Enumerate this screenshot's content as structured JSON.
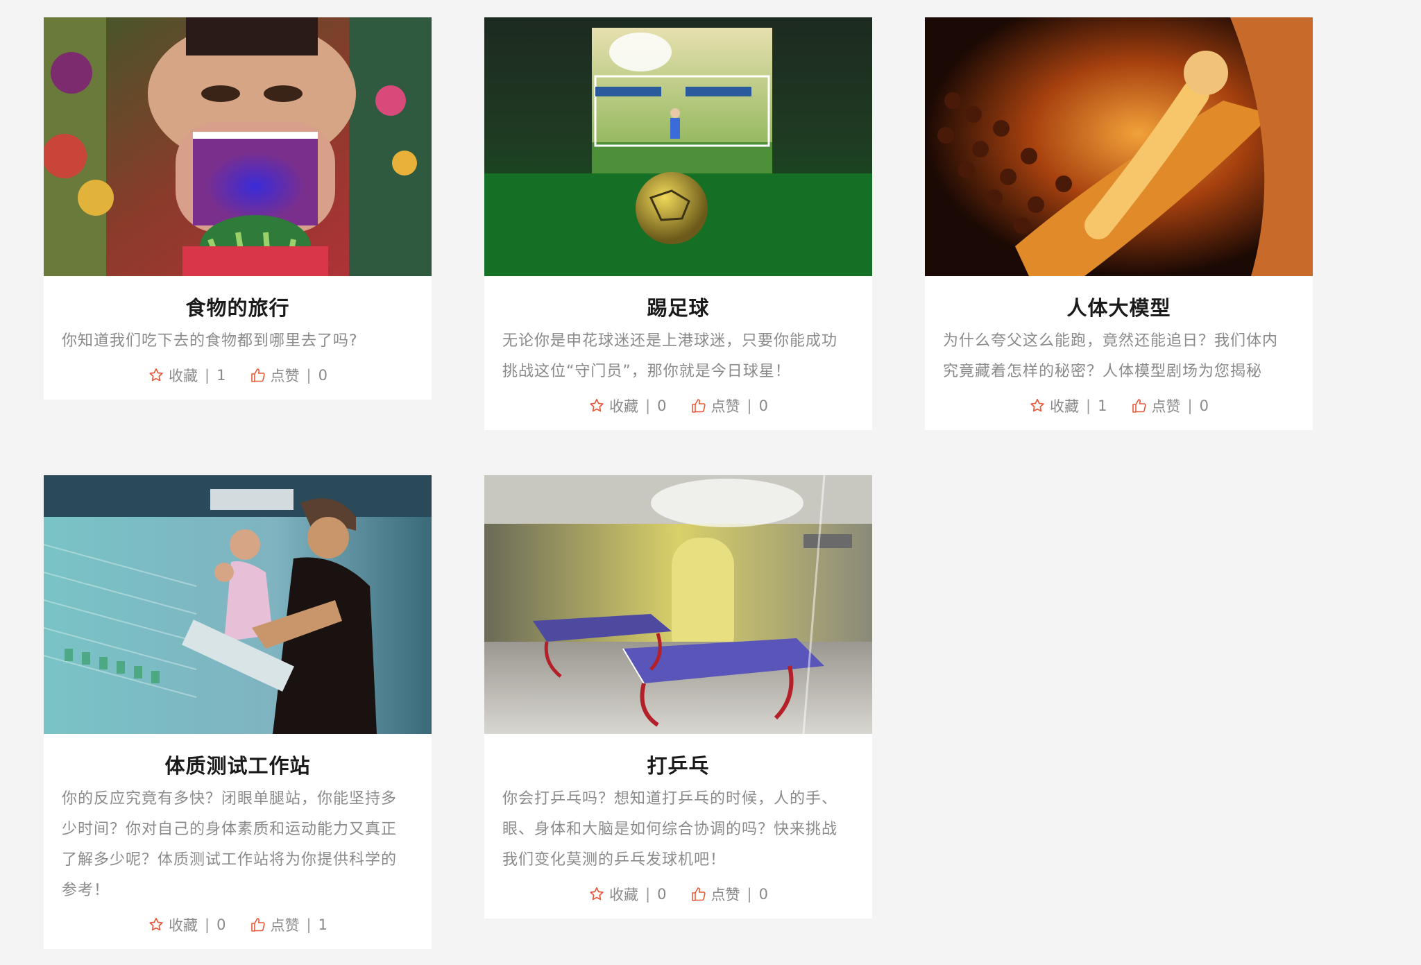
{
  "accent_color": "#e8583a",
  "cards": [
    {
      "title": "食物的旅行",
      "desc_lines": [
        "你知道我们吃下去的食物都到哪里去了吗?"
      ],
      "favorite_label": "收藏",
      "favorite_count": "1",
      "like_label": "点赞",
      "like_count": "0",
      "image_icon": "food-journey-exhibit-image"
    },
    {
      "title": "踢足球",
      "desc_lines": [
        "无论你是申花球迷还是上港球迷，只要你能成功",
        "挑战这位“守门员”，那你就是今日球星！"
      ],
      "favorite_label": "收藏",
      "favorite_count": "0",
      "like_label": "点赞",
      "like_count": "0",
      "image_icon": "soccer-goal-image"
    },
    {
      "title": "人体大模型",
      "desc_lines": [
        "为什么夸父这么能跑，竟然还能追日？我们体内",
        "究竟藏着怎样的秘密？人体模型剧场为您揭秘"
      ],
      "favorite_label": "收藏",
      "favorite_count": "1",
      "like_label": "点赞",
      "like_count": "0",
      "image_icon": "human-body-model-image"
    },
    {
      "title": "体质测试工作站",
      "desc_lines": [
        "你的反应究竟有多快？闭眼单腿站，你能坚持多",
        "少时间？你对自己的身体素质和运动能力又真正",
        "了解多少呢？体质测试工作站将为你提供科学的",
        "参考！"
      ],
      "favorite_label": "收藏",
      "favorite_count": "0",
      "like_label": "点赞",
      "like_count": "1",
      "image_icon": "fitness-test-station-image"
    },
    {
      "title": "打乒乓",
      "desc_lines": [
        "你会打乒乓吗？想知道打乒乓的时候，人的手、",
        "眼、身体和大脑是如何综合协调的吗？快来挑战",
        "我们变化莫测的乒乓发球机吧！"
      ],
      "favorite_label": "收藏",
      "favorite_count": "0",
      "like_label": "点赞",
      "like_count": "0",
      "image_icon": "ping-pong-tables-image"
    }
  ]
}
